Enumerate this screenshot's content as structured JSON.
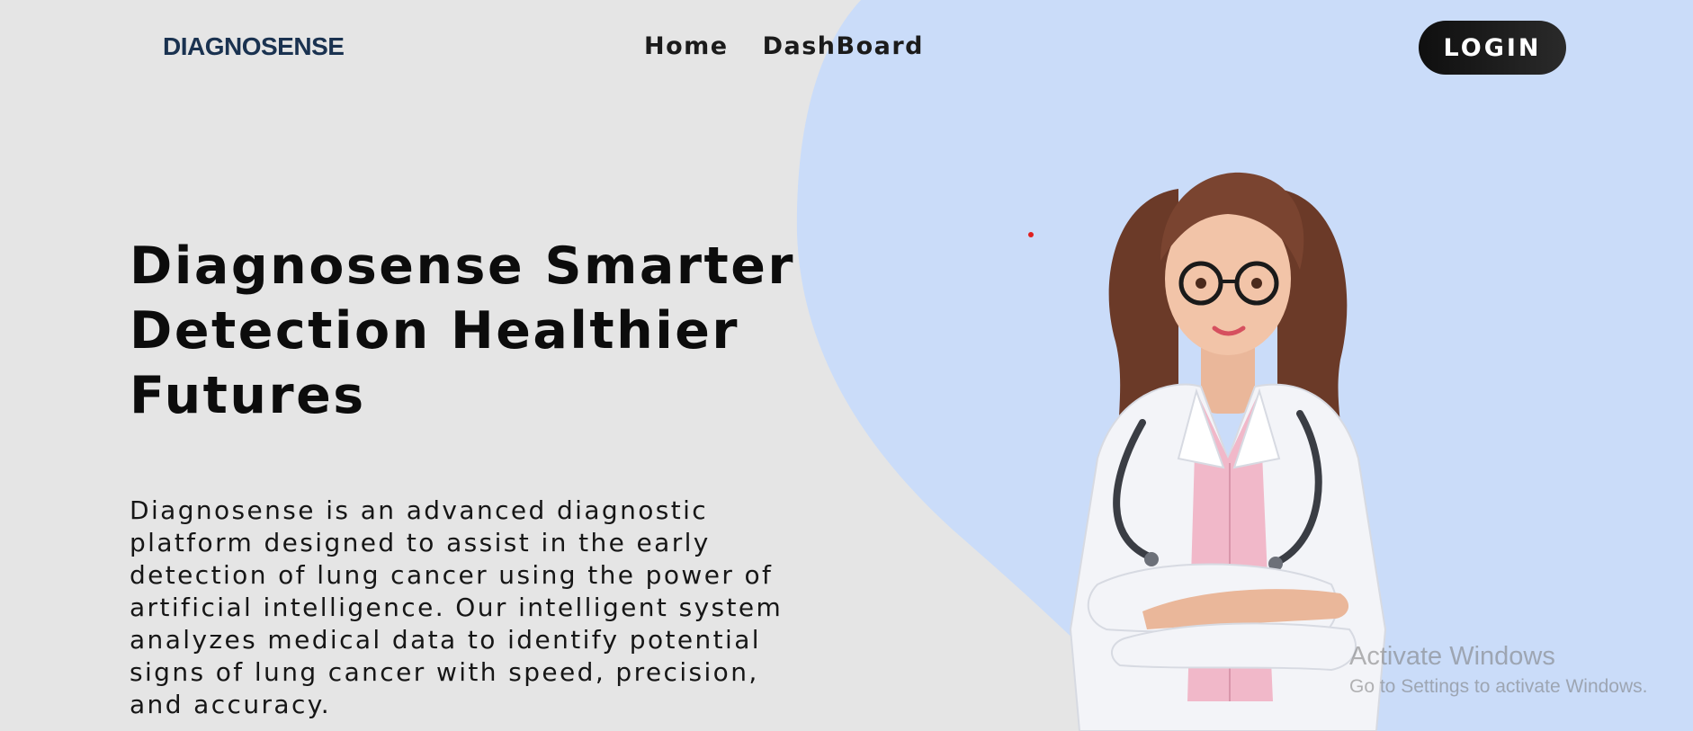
{
  "header": {
    "logo": "DIAGNOSENSE",
    "nav": [
      {
        "label": "Home"
      },
      {
        "label": "DashBoard"
      }
    ],
    "login_label": "LOGIN"
  },
  "hero": {
    "title": "Diagnosense Smarter Detection Healthier Futures",
    "description": "Diagnosense is an advanced diagnostic platform designed to assist in the early detection of lung cancer using the power of artificial intelligence. Our intelligent system analyzes medical data to identify potential signs of lung cancer with speed, precision, and accuracy."
  },
  "illustration": {
    "icon": "doctor-illustration",
    "colors": {
      "hair": "#6b3a28",
      "coat": "#f3f4f8",
      "shirt": "#f1b8c9",
      "skin": "#f2c4a8",
      "glasses": "#1a1a1a",
      "stethoscope": "#3a3d44"
    }
  },
  "windows_watermark": {
    "title": "Activate Windows",
    "subtitle": "Go to Settings to activate Windows."
  },
  "colors": {
    "background": "#e5e5e5",
    "blob": "#cadcf9",
    "logo": "#1a3250",
    "button_bg": "#111111",
    "button_text": "#ffffff",
    "text": "#111111",
    "dot": "#e02020"
  }
}
